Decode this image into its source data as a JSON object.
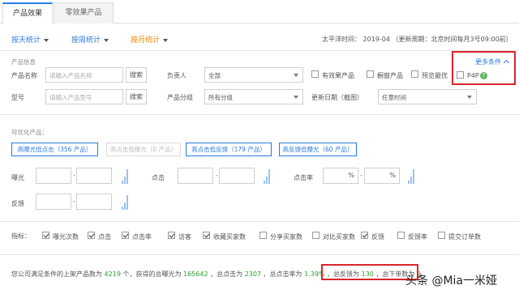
{
  "tabs": [
    "产品效果",
    "零效果产品"
  ],
  "timebar": {
    "by_day": "按天统计",
    "by_week": "按周统计",
    "by_month": "按月统计",
    "info": "太平洋时间：   2019-04   （更新周期：北京时间每月3号09:00前）"
  },
  "filter": {
    "section_title": "产品信息",
    "product_name_label": "产品名称",
    "product_name_placeholder": "请输入产品名称",
    "search_label": "搜索",
    "owner_label": "负责人",
    "owner_value": "全部",
    "model_label": "型号",
    "model_placeholder": "请输入产品型号",
    "group_label": "产品分组",
    "group_value": "所有分组",
    "update_label": "更新日期（截图）",
    "update_value": "任意时间",
    "checkboxes": [
      "有效果产品",
      "橱窗产品",
      "预览最优"
    ],
    "more_conditions": "更多条件",
    "p4p": "P4P",
    "p4p_help": "?"
  },
  "optimize": {
    "title": "可优化产品：",
    "chips": [
      {
        "label": "高曝光低点击（356 产品）",
        "disabled": false
      },
      {
        "label": "高点击低曝光（0 产品）",
        "disabled": true
      },
      {
        "label": "高点击低反馈（179 产品）",
        "disabled": false
      },
      {
        "label": "高反馈低曝光（60 产品）",
        "disabled": false
      }
    ],
    "row1": [
      "曝光",
      "点击",
      "点击率"
    ],
    "row2": [
      "反馈"
    ]
  },
  "metrics": {
    "label": "指标：",
    "items": [
      {
        "label": "曝光次数",
        "checked": true
      },
      {
        "label": "点击",
        "checked": true
      },
      {
        "label": "点击率",
        "checked": true
      },
      {
        "label": "访客",
        "checked": true
      },
      {
        "label": "收藏买家数",
        "checked": true
      },
      {
        "label": "分享买家数",
        "checked": false
      },
      {
        "label": "对比买家数",
        "checked": false
      },
      {
        "label": "反馈",
        "checked": true
      },
      {
        "label": "反馈率",
        "checked": false
      },
      {
        "label": "提交订单数",
        "checked": false
      }
    ]
  },
  "summary": {
    "p1": "您公司满足条件的上架产品数为",
    "count": "4219",
    "p2": "个，获得的总曝光为",
    "exposure": "165642",
    "p3": "，总点击为",
    "clicks": "2307",
    "p4": "，总点击率为",
    "ctr": "1.39%",
    "p5": "，总反馈为",
    "feedback": "130",
    "p6": "，总下单数为",
    "orders": "9"
  },
  "watermark": "头条 @Mia一米娅"
}
